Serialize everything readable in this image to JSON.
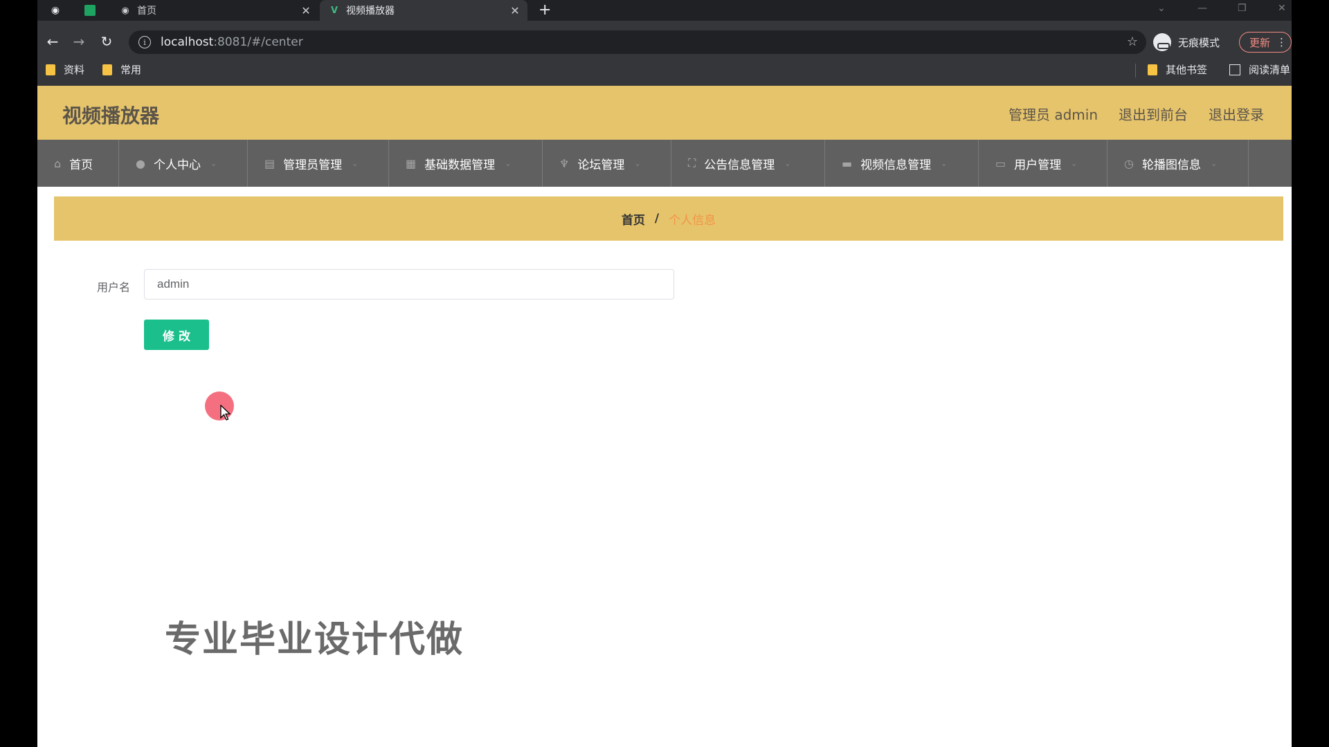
{
  "browser": {
    "tabs": [
      {
        "title": "首页",
        "favicon": "globe-icon"
      },
      {
        "title": "视频播放器",
        "favicon": "vue-icon"
      }
    ],
    "new_tab": "+",
    "url_host": "localhost",
    "url_rest": ":8081/#/center",
    "incognito_label": "无痕模式",
    "update_label": "更新",
    "bookmarks": [
      "资料",
      "常用"
    ],
    "other_bookmarks": "其他书签",
    "reading_list": "阅读清单"
  },
  "app": {
    "title": "视频播放器",
    "header_links": [
      "管理员 admin",
      "退出到前台",
      "退出登录"
    ],
    "menu": [
      {
        "label": "首页",
        "icon": "home-icon",
        "dropdown": false
      },
      {
        "label": "个人中心",
        "icon": "user-icon",
        "dropdown": true
      },
      {
        "label": "管理员管理",
        "icon": "document-icon",
        "dropdown": true
      },
      {
        "label": "基础数据管理",
        "icon": "grid-icon",
        "dropdown": true
      },
      {
        "label": "论坛管理",
        "icon": "microphone-icon",
        "dropdown": true
      },
      {
        "label": "公告信息管理",
        "icon": "frame-icon",
        "dropdown": true
      },
      {
        "label": "视频信息管理",
        "icon": "chat-icon",
        "dropdown": true
      },
      {
        "label": "用户管理",
        "icon": "folder-icon",
        "dropdown": true
      },
      {
        "label": "轮播图信息",
        "icon": "clock-icon",
        "dropdown": true
      }
    ],
    "breadcrumb": {
      "home": "首页",
      "separator": "/",
      "current": "个人信息"
    },
    "form": {
      "username_label": "用户名",
      "username_value": "admin",
      "submit_label": "修改"
    }
  },
  "watermark": "专业毕业设计代做",
  "colors": {
    "header_bg": "#e6c46c",
    "menu_bg": "#606060",
    "primary_button": "#1bbf8c",
    "breadcrumb_current": "#f29445"
  }
}
